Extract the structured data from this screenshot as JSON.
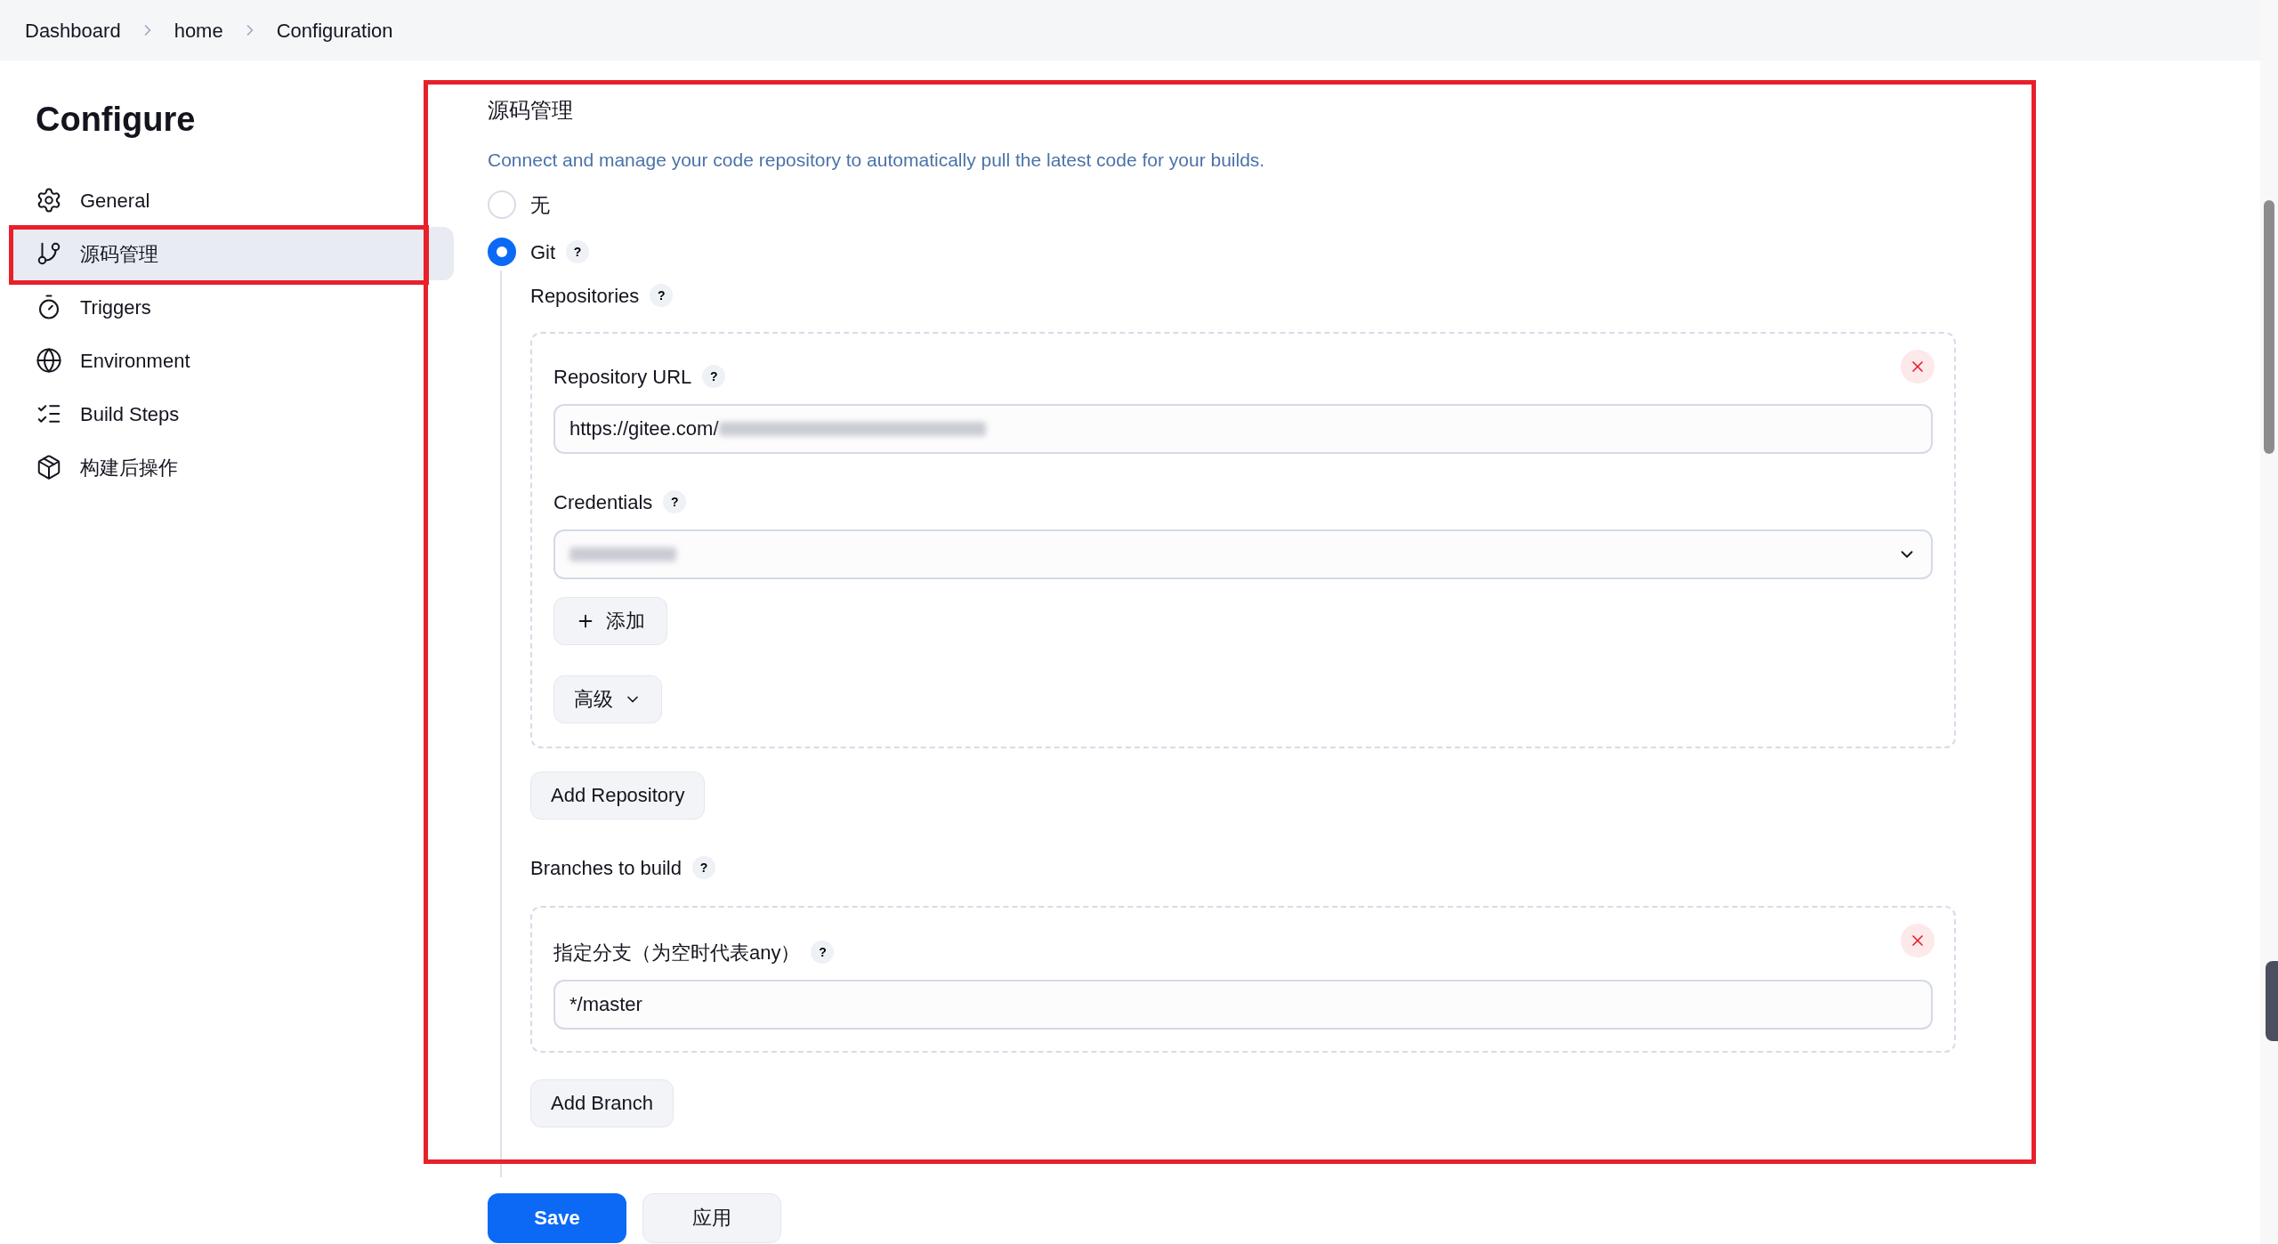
{
  "breadcrumbs": [
    "Dashboard",
    "home",
    "Configuration"
  ],
  "sidebar": {
    "title": "Configure",
    "items": [
      {
        "label": "General",
        "selected": false
      },
      {
        "label": "源码管理",
        "selected": true
      },
      {
        "label": "Triggers",
        "selected": false
      },
      {
        "label": "Environment",
        "selected": false
      },
      {
        "label": "Build Steps",
        "selected": false
      },
      {
        "label": "构建后操作",
        "selected": false
      }
    ]
  },
  "section": {
    "title": "源码管理",
    "description": "Connect and manage your code repository to automatically pull the latest code for your builds.",
    "options": [
      {
        "label": "无",
        "selected": false
      },
      {
        "label": "Git",
        "selected": true,
        "help": "?"
      }
    ],
    "repositories": {
      "label": "Repositories",
      "help": "?",
      "url_label": "Repository URL",
      "url_help": "?",
      "url_value": "https://gitee.com/",
      "credentials_label": "Credentials",
      "credentials_help": "?",
      "add_button": "添加",
      "advanced_button": "高级",
      "add_repository": "Add Repository"
    },
    "branches": {
      "label": "Branches to build",
      "help": "?",
      "spec_label": "指定分支（为空时代表any）",
      "spec_help": "?",
      "spec_value": "*/master",
      "add_branch": "Add Branch"
    }
  },
  "buttons": {
    "save": "Save",
    "apply": "应用"
  }
}
